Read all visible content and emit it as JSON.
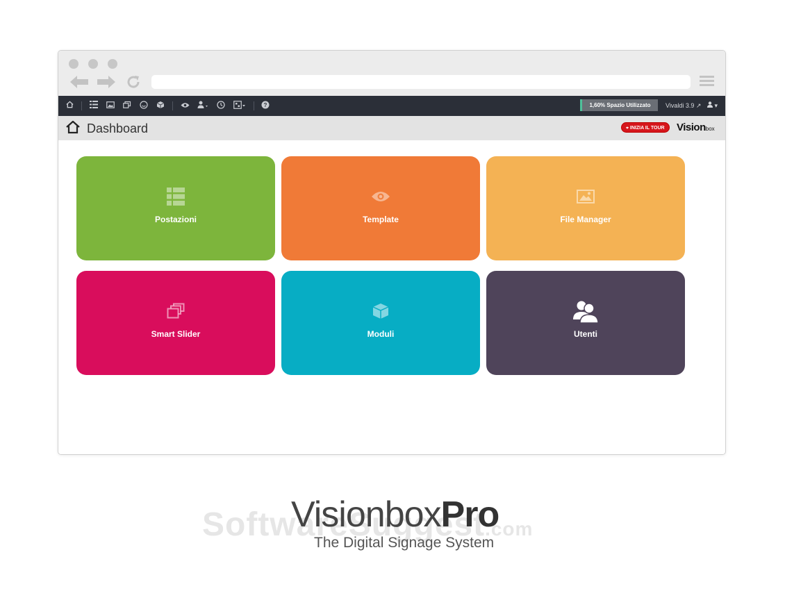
{
  "browser": {
    "address_value": ""
  },
  "toolbar": {
    "storage_label": "1,60% Spazio Utilizzato",
    "storage_percent": 1.6,
    "version_label": "Vivaldi 3.9 ↗",
    "user_menu_label": "▾"
  },
  "header": {
    "title": "Dashboard",
    "tour_button_label": "INIZIA IL TOUR",
    "brand_text": "Vision",
    "brand_suffix": "box"
  },
  "tiles": [
    {
      "label": "Postazioni",
      "icon": "list-icon",
      "color": "#7db53c"
    },
    {
      "label": "Template",
      "icon": "eye-icon",
      "color": "#f07a37"
    },
    {
      "label": "File Manager",
      "icon": "image-icon",
      "color": "#f4b254"
    },
    {
      "label": "Smart Slider",
      "icon": "slides-icon",
      "color": "#d90d5c"
    },
    {
      "label": "Moduli",
      "icon": "cube-icon",
      "color": "#07adc4"
    },
    {
      "label": "Utenti",
      "icon": "users-icon",
      "color": "#4f445a"
    }
  ],
  "footer": {
    "product_name": "Visionbox",
    "product_suffix": "Pro",
    "tagline": "The Digital Signage System",
    "watermark": "SoftwareSuggest",
    "watermark_tld": ".com"
  }
}
